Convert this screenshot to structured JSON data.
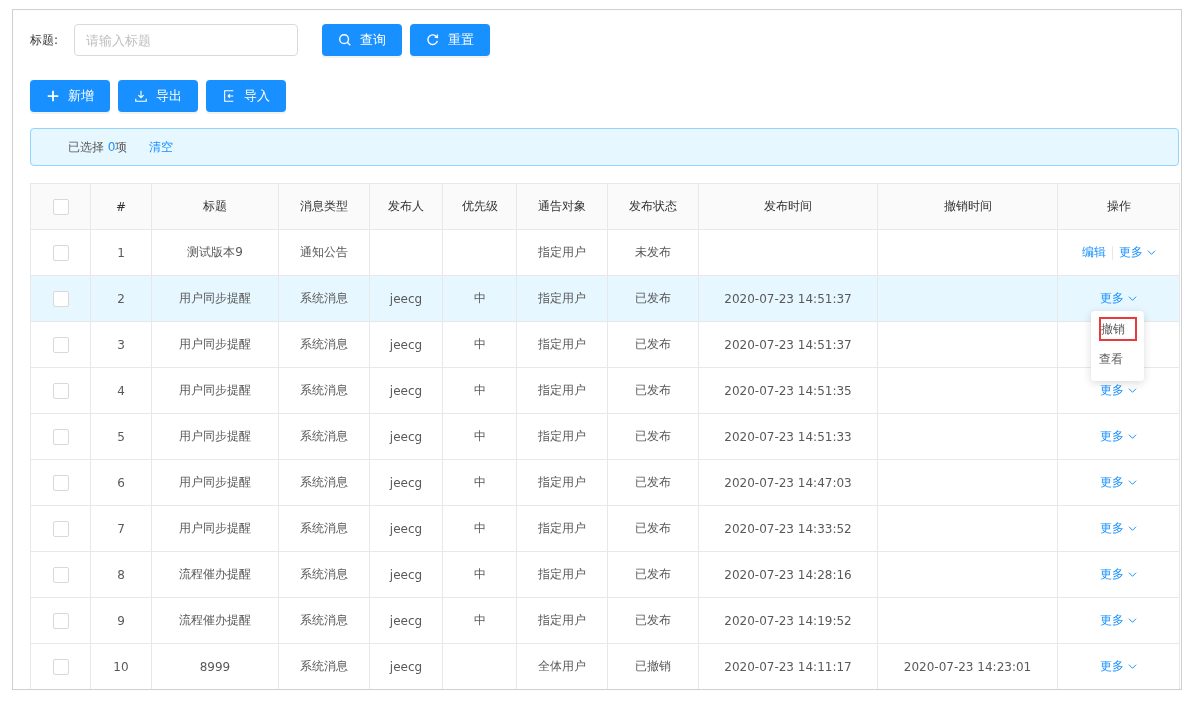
{
  "search": {
    "label": "标题:",
    "placeholder": "请输入标题"
  },
  "search_buttons": [
    {
      "kind": "search",
      "label": "查询"
    },
    {
      "kind": "reset",
      "label": "重置"
    }
  ],
  "toolbar": [
    {
      "kind": "add",
      "label": "新增"
    },
    {
      "kind": "export",
      "label": "导出"
    },
    {
      "kind": "import",
      "label": "导入"
    }
  ],
  "selection_info": {
    "prefix": "已选择",
    "count": "0",
    "suffix": "项",
    "clear": "清空"
  },
  "table": {
    "columns": [
      "#",
      "标题",
      "消息类型",
      "发布人",
      "优先级",
      "通告对象",
      "发布状态",
      "发布时间",
      "撤销时间",
      "操作"
    ],
    "header_checked": false,
    "rows": [
      {
        "checked": false,
        "hovered": false,
        "cells": [
          "1",
          "测试版本9",
          "通知公告",
          "",
          "",
          "指定用户",
          "未发布",
          "",
          ""
        ],
        "actions": [
          "编辑",
          "更多"
        ]
      },
      {
        "checked": false,
        "hovered": true,
        "cells": [
          "2",
          "用户同步提醒",
          "系统消息",
          "jeecg",
          "中",
          "指定用户",
          "已发布",
          "2020-07-23 14:51:37",
          ""
        ],
        "actions": [
          "更多"
        ]
      },
      {
        "checked": false,
        "hovered": false,
        "cells": [
          "3",
          "用户同步提醒",
          "系统消息",
          "jeecg",
          "中",
          "指定用户",
          "已发布",
          "2020-07-23 14:51:37",
          ""
        ],
        "actions": []
      },
      {
        "checked": false,
        "hovered": false,
        "cells": [
          "4",
          "用户同步提醒",
          "系统消息",
          "jeecg",
          "中",
          "指定用户",
          "已发布",
          "2020-07-23 14:51:35",
          ""
        ],
        "actions": [
          "更多"
        ]
      },
      {
        "checked": false,
        "hovered": false,
        "cells": [
          "5",
          "用户同步提醒",
          "系统消息",
          "jeecg",
          "中",
          "指定用户",
          "已发布",
          "2020-07-23 14:51:33",
          ""
        ],
        "actions": [
          "更多"
        ]
      },
      {
        "checked": false,
        "hovered": false,
        "cells": [
          "6",
          "用户同步提醒",
          "系统消息",
          "jeecg",
          "中",
          "指定用户",
          "已发布",
          "2020-07-23 14:47:03",
          ""
        ],
        "actions": [
          "更多"
        ]
      },
      {
        "checked": false,
        "hovered": false,
        "cells": [
          "7",
          "用户同步提醒",
          "系统消息",
          "jeecg",
          "中",
          "指定用户",
          "已发布",
          "2020-07-23 14:33:52",
          ""
        ],
        "actions": [
          "更多"
        ]
      },
      {
        "checked": false,
        "hovered": false,
        "cells": [
          "8",
          "流程催办提醒",
          "系统消息",
          "jeecg",
          "中",
          "指定用户",
          "已发布",
          "2020-07-23 14:28:16",
          ""
        ],
        "actions": [
          "更多"
        ]
      },
      {
        "checked": false,
        "hovered": false,
        "cells": [
          "9",
          "流程催办提醒",
          "系统消息",
          "jeecg",
          "中",
          "指定用户",
          "已发布",
          "2020-07-23 14:19:52",
          ""
        ],
        "actions": [
          "更多"
        ]
      },
      {
        "checked": false,
        "hovered": false,
        "cells": [
          "10",
          "8999",
          "系统消息",
          "jeecg",
          "",
          "全体用户",
          "已撤销",
          "2020-07-23 14:11:17",
          "2020-07-23 14:23:01"
        ],
        "actions": [
          "更多"
        ]
      }
    ]
  },
  "dropdown_menu": {
    "items": [
      {
        "label": "撤销",
        "highlighted": true
      },
      {
        "label": "查看",
        "highlighted": false
      }
    ]
  }
}
